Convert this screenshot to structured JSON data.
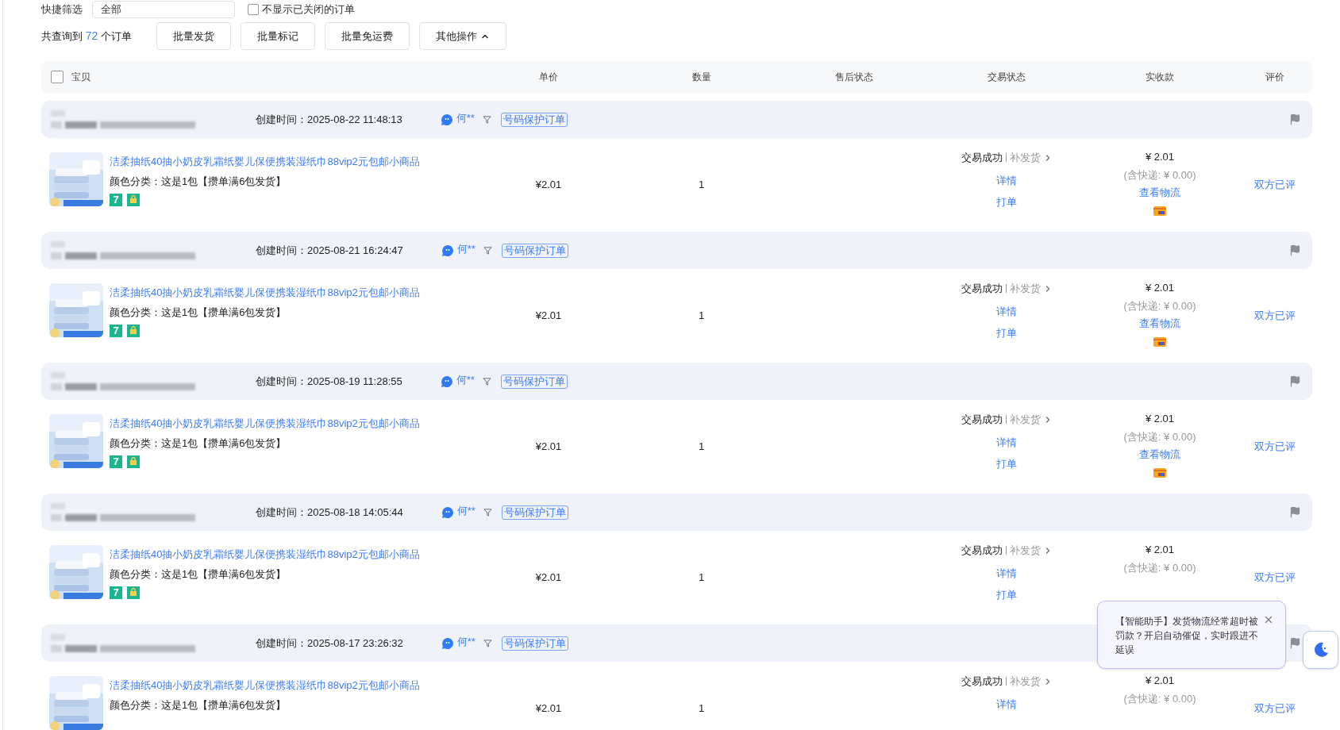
{
  "filters": {
    "quick_label": "快捷筛选",
    "select_value": "全部",
    "hide_closed": {
      "label": "不显示已关闭的订单",
      "checked": false
    }
  },
  "toolbar": {
    "count_prefix": "共查询到",
    "count": "72",
    "count_suffix": "个订单",
    "buttons": [
      "批量发货",
      "批量标记",
      "批量免运费"
    ],
    "more": {
      "label": "其他操作",
      "expanded": true
    }
  },
  "table": {
    "select_all": {
      "checked": false
    },
    "columns": [
      "宝贝",
      "单价",
      "数量",
      "售后状态",
      "交易状态",
      "实收款",
      "评价"
    ]
  },
  "orders": [
    {
      "created_label": "创建时间：",
      "created": "2025-08-22 11:48:13",
      "buyer": "何**",
      "tag": "号码保护订单",
      "item": {
        "title": "洁柔抽纸40抽小奶皮乳霜纸婴儿保便携装湿纸巾88vip2元包邮小商品",
        "sku": "颜色分类：这是1包【攒单满6包发货】",
        "badge": "7",
        "price": "¥2.01",
        "qty": "1",
        "status": "交易成功",
        "resend": "补发货",
        "links": [
          "详情",
          "打单"
        ],
        "amount": "¥ 2.01",
        "shipping": "(含快递: ¥ 0.00)",
        "logistics": "查看物流",
        "review": "双方已评"
      }
    },
    {
      "created_label": "创建时间：",
      "created": "2025-08-21 16:24:47",
      "buyer": "何**",
      "tag": "号码保护订单",
      "item": {
        "title": "洁柔抽纸40抽小奶皮乳霜纸婴儿保便携装湿纸巾88vip2元包邮小商品",
        "sku": "颜色分类：这是1包【攒单满6包发货】",
        "badge": "7",
        "price": "¥2.01",
        "qty": "1",
        "status": "交易成功",
        "resend": "补发货",
        "links": [
          "详情",
          "打单"
        ],
        "amount": "¥ 2.01",
        "shipping": "(含快递: ¥ 0.00)",
        "logistics": "查看物流",
        "review": "双方已评"
      }
    },
    {
      "created_label": "创建时间：",
      "created": "2025-08-19 11:28:55",
      "buyer": "何**",
      "tag": "号码保护订单",
      "item": {
        "title": "洁柔抽纸40抽小奶皮乳霜纸婴儿保便携装湿纸巾88vip2元包邮小商品",
        "sku": "颜色分类：这是1包【攒单满6包发货】",
        "badge": "7",
        "price": "¥2.01",
        "qty": "1",
        "status": "交易成功",
        "resend": "补发货",
        "links": [
          "详情",
          "打单"
        ],
        "amount": "¥ 2.01",
        "shipping": "(含快递: ¥ 0.00)",
        "logistics": "查看物流",
        "review": "双方已评"
      }
    },
    {
      "created_label": "创建时间：",
      "created": "2025-08-18 14:05:44",
      "buyer": "何**",
      "tag": "号码保护订单",
      "item": {
        "title": "洁柔抽纸40抽小奶皮乳霜纸婴儿保便携装湿纸巾88vip2元包邮小商品",
        "sku": "颜色分类：这是1包【攒单满6包发货】",
        "badge": "7",
        "price": "¥2.01",
        "qty": "1",
        "status": "交易成功",
        "resend": "补发货",
        "links": [
          "详情",
          "打单"
        ],
        "amount": "¥ 2.01",
        "shipping": "(含快递: ¥ 0.00)",
        "review": "双方已评"
      }
    },
    {
      "created_label": "创建时间：",
      "created": "2025-08-17 23:26:32",
      "buyer": "何**",
      "tag": "号码保护订单",
      "item": {
        "title": "洁柔抽纸40抽小奶皮乳霜纸婴儿保便携装湿纸巾88vip2元包邮小商品",
        "sku": "颜色分类：这是1包【攒单满6包发货】",
        "price": "¥2.01",
        "qty": "1",
        "status": "交易成功",
        "resend": "补发货",
        "links": [
          "详情"
        ],
        "amount": "¥ 2.01",
        "shipping": "(含快递: ¥ 0.00)",
        "review": "双方已评"
      }
    }
  ],
  "assistant_popup": {
    "text": "【智能助手】发货物流经常超时被罚款？开启自动催促，实时跟进不延误"
  }
}
